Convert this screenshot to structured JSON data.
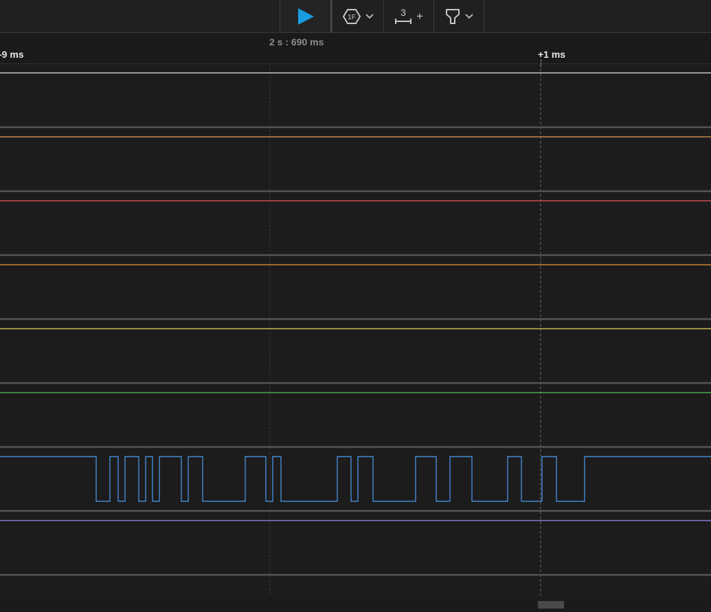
{
  "toolbar": {
    "play_icon": "play-icon",
    "trigger_icon": "trigger-hexagon-icon",
    "trigger_badge": "1F",
    "measure_icon": "measurement-marker-icon",
    "measure_count": "3",
    "measure_add": "+",
    "filter_icon": "filter-funnel-icon"
  },
  "timeline": {
    "left_label": "-9 ms",
    "cursor_label": "2 s : 690 ms",
    "marker_label": "+1 ms"
  },
  "colors": {
    "accent_play": "#1a9de0",
    "channels": [
      "#e8e8e8",
      "#e3a05a",
      "#ee5a5a",
      "#f09a3a",
      "#e7d95a",
      "#4fc85a",
      "#4a9ff5",
      "#9a8af0"
    ]
  },
  "channels": [
    {
      "id": 0,
      "color": "#e8e8e8",
      "state": "high"
    },
    {
      "id": 1,
      "color": "#e3a05a",
      "state": "high"
    },
    {
      "id": 2,
      "color": "#ee5a5a",
      "state": "high"
    },
    {
      "id": 3,
      "color": "#f09a3a",
      "state": "high"
    },
    {
      "id": 4,
      "color": "#e7d95a",
      "state": "high"
    },
    {
      "id": 5,
      "color": "#4fc85a",
      "state": "high"
    },
    {
      "id": 6,
      "color": "#4a9ff5",
      "state": "toggling"
    },
    {
      "id": 7,
      "color": "#9a8af0",
      "state": "high"
    }
  ]
}
